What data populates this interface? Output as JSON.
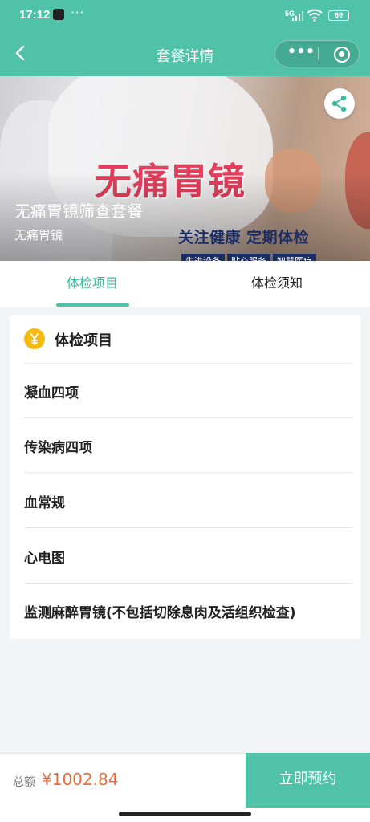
{
  "status_bar": {
    "time": "17:12",
    "more": "···",
    "network": "5G",
    "battery": "69"
  },
  "header": {
    "title": "套餐详情",
    "capsule_more": "•••"
  },
  "banner": {
    "headline": "无痛胃镜",
    "slogan": "关注健康  定期体检",
    "chips": [
      "先进设备",
      "贴心服务",
      "智慧医疗"
    ],
    "package_name": "无痛胃镜筛查套餐",
    "package_category": "无痛胃镜"
  },
  "tabs": [
    {
      "label": "体检项目",
      "active": true
    },
    {
      "label": "体检须知",
      "active": false
    }
  ],
  "items_card": {
    "title": "体检项目",
    "items": [
      "凝血四项",
      "传染病四项",
      "血常规",
      "心电图",
      "监测麻醉胃镜(不包括切除息肉及活组织检查)"
    ]
  },
  "footer": {
    "total_label": "总额",
    "price": "¥1002.84",
    "book_label": "立即预约"
  },
  "colors": {
    "brand": "#4fc2a7",
    "price": "#e96b3a",
    "badge": "#f5b914"
  }
}
